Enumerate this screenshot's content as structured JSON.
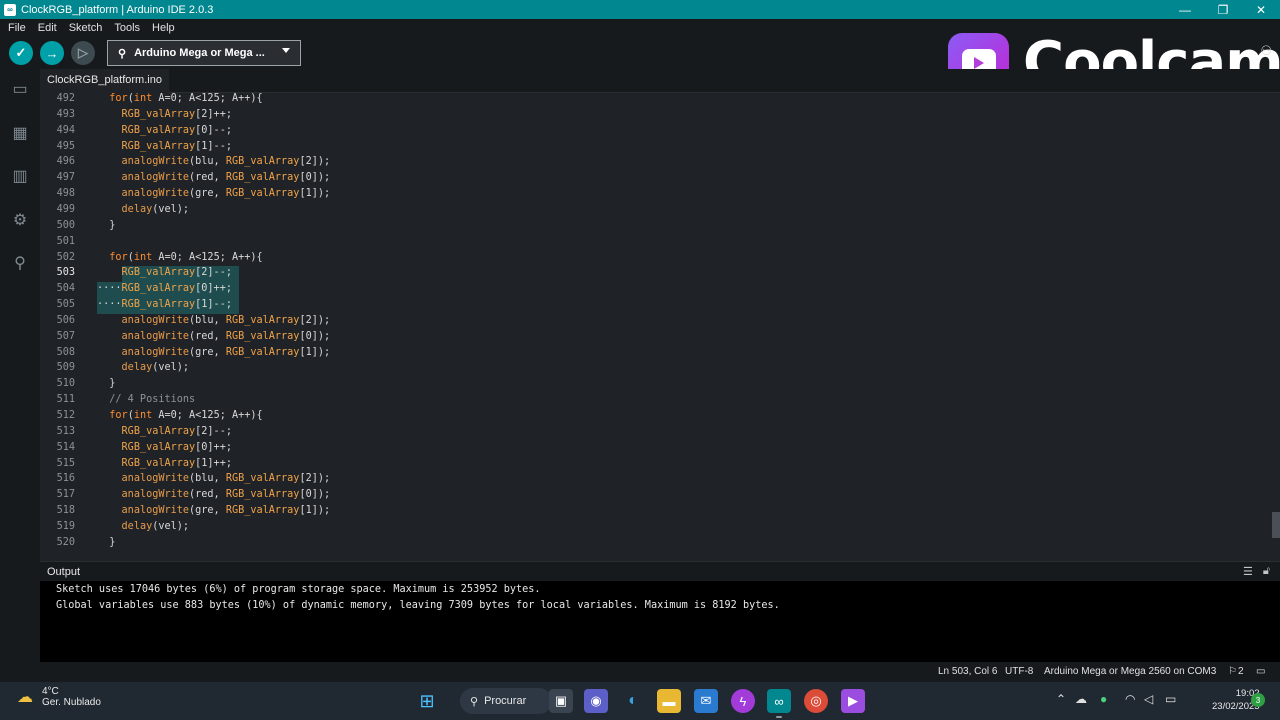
{
  "window": {
    "title": "ClockRGB_platform | Arduino IDE 2.0.3",
    "app_icon_glyph": "∞",
    "minimize_glyph": "—",
    "restore_glyph": "❐",
    "close_glyph": "✕"
  },
  "menu": [
    "File",
    "Edit",
    "Sketch",
    "Tools",
    "Help"
  ],
  "toolbar": {
    "verify_glyph": "✓",
    "upload_glyph": "→",
    "debug_glyph": "▷",
    "board_icon": "⚲",
    "board_label": "Arduino Mega or Mega ..."
  },
  "overlay": {
    "brand": "Coolcam"
  },
  "tab": {
    "label": "ClockRGB_platform.ino"
  },
  "editor": {
    "active_line": "503",
    "lines": [
      {
        "n": "492",
        "code": "  for(int A=0; A<125; A++){"
      },
      {
        "n": "493",
        "code": "    RGB_valArray[2]++;"
      },
      {
        "n": "494",
        "code": "    RGB_valArray[0]--;"
      },
      {
        "n": "495",
        "code": "    RGB_valArray[1]--;"
      },
      {
        "n": "496",
        "code": "    analogWrite(blu, RGB_valArray[2]);"
      },
      {
        "n": "497",
        "code": "    analogWrite(red, RGB_valArray[0]);"
      },
      {
        "n": "498",
        "code": "    analogWrite(gre, RGB_valArray[1]);"
      },
      {
        "n": "499",
        "code": "    delay(vel);"
      },
      {
        "n": "500",
        "code": "  }"
      },
      {
        "n": "501",
        "code": ""
      },
      {
        "n": "502",
        "code": "  for(int A=0; A<125; A++){"
      },
      {
        "n": "503",
        "code": "    RGB_valArray[2]--;"
      },
      {
        "n": "504",
        "code": "····RGB_valArray[0]++;"
      },
      {
        "n": "505",
        "code": "····RGB_valArray[1]--;"
      },
      {
        "n": "506",
        "code": "    analogWrite(blu, RGB_valArray[2]);"
      },
      {
        "n": "507",
        "code": "    analogWrite(red, RGB_valArray[0]);"
      },
      {
        "n": "508",
        "code": "    analogWrite(gre, RGB_valArray[1]);"
      },
      {
        "n": "509",
        "code": "    delay(vel);"
      },
      {
        "n": "510",
        "code": "  }"
      },
      {
        "n": "511",
        "code": "  // 4 Positions"
      },
      {
        "n": "512",
        "code": "  for(int A=0; A<125; A++){"
      },
      {
        "n": "513",
        "code": "    RGB_valArray[2]--;"
      },
      {
        "n": "514",
        "code": "    RGB_valArray[0]++;"
      },
      {
        "n": "515",
        "code": "    RGB_valArray[1]++;"
      },
      {
        "n": "516",
        "code": "    analogWrite(blu, RGB_valArray[2]);"
      },
      {
        "n": "517",
        "code": "    analogWrite(red, RGB_valArray[0]);"
      },
      {
        "n": "518",
        "code": "    analogWrite(gre, RGB_valArray[1]);"
      },
      {
        "n": "519",
        "code": "    delay(vel);"
      },
      {
        "n": "520",
        "code": "  }"
      }
    ]
  },
  "output": {
    "title": "Output",
    "lines": [
      "Sketch uses 17046 bytes (6%) of program storage space. Maximum is 253952 bytes.",
      "Global variables use 883 bytes (10%) of dynamic memory, leaving 7309 bytes for local variables. Maximum is 8192 bytes."
    ]
  },
  "status": {
    "position": "Ln 503, Col 6",
    "encoding": "UTF-8",
    "board_port": "Arduino Mega or Mega 2560 on COM3",
    "notifications": "2"
  },
  "taskbar": {
    "temperature": "4°C",
    "weather": "Ger. Nublado",
    "search_label": "Procurar",
    "time": "19:02",
    "date": "23/02/2023",
    "badge": "3"
  }
}
